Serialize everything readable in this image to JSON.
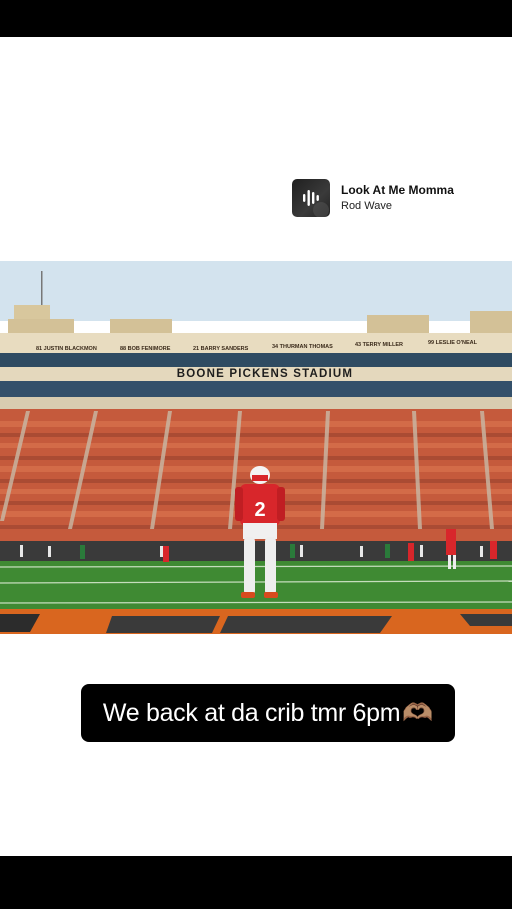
{
  "music": {
    "song": "Look At Me Momma",
    "artist": "Rod Wave",
    "icon": "waveform-icon"
  },
  "photo": {
    "stadium_name": "BOONE PICKENS STADIUM",
    "ring_names": [
      "81 JUSTIN BLACKMON",
      "88 BOB FENIMORE",
      "21 BARRY SANDERS",
      "34 THURMAN THOMAS",
      "43 TERRY MILLER",
      "99 LESLIE O'NEAL"
    ],
    "jersey_number": "2",
    "colors": {
      "sky": "#cfe1ee",
      "crowd": "#c9573a",
      "turf": "#3f8a33",
      "endzone": "#d9661f",
      "jersey": "#d8262b"
    }
  },
  "caption": {
    "text": "We back at da crib tmr 6pm",
    "emoji": "🫶🏽"
  }
}
